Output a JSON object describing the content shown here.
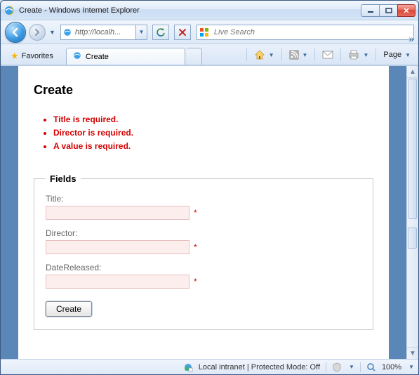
{
  "window": {
    "title": "Create - Windows Internet Explorer"
  },
  "nav": {
    "address": "http://localh...",
    "search_placeholder": "Live Search"
  },
  "favbar": {
    "favorites": "Favorites"
  },
  "tab": {
    "title": "Create"
  },
  "cmdbar": {
    "page": "Page"
  },
  "page": {
    "heading": "Create",
    "errors": [
      "Title is required.",
      "Director is required.",
      "A value is required."
    ],
    "legend": "Fields",
    "fields": {
      "title_label": "Title:",
      "director_label": "Director:",
      "datereleased_label": "DateReleased:",
      "required_mark": "*"
    },
    "submit": "Create"
  },
  "status": {
    "zone": "Local intranet | Protected Mode: Off",
    "zoom": "100%"
  }
}
